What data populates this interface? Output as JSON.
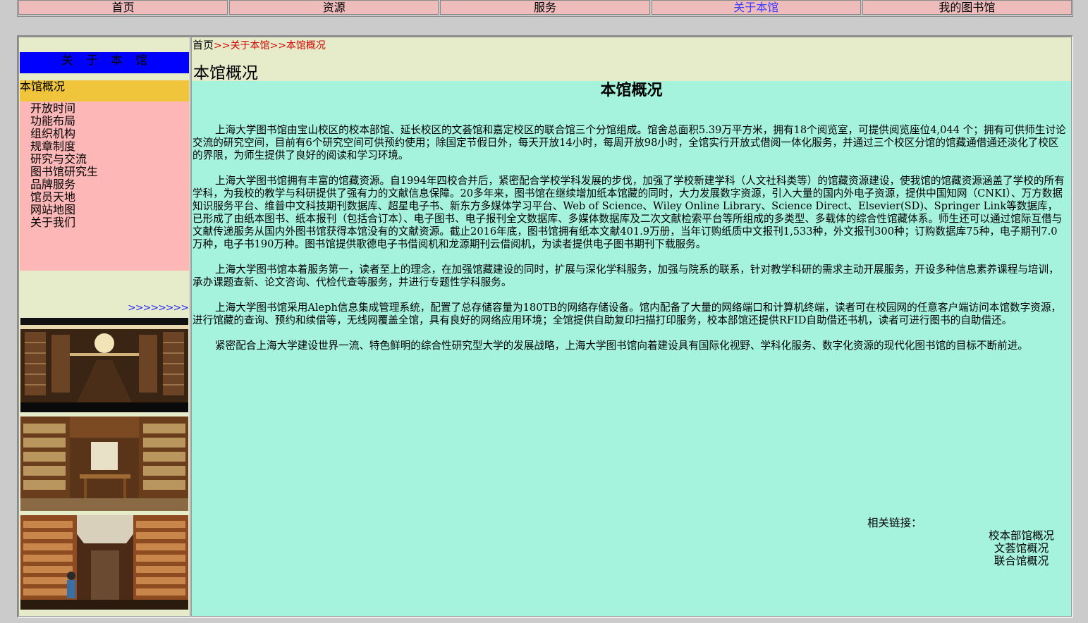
{
  "topnav": {
    "items": [
      {
        "label": "首页"
      },
      {
        "label": "资源"
      },
      {
        "label": "服务"
      },
      {
        "label": "关于本馆"
      },
      {
        "label": "我的图书馆"
      }
    ]
  },
  "sidebar": {
    "header": "关于本馆",
    "current": "本馆概况",
    "items": [
      {
        "label": "开放时间"
      },
      {
        "label": "功能布局"
      },
      {
        "label": "组织机构"
      },
      {
        "label": "规章制度"
      },
      {
        "label": "研究与交流"
      },
      {
        "label": "图书馆研究生"
      },
      {
        "label": "品牌服务"
      },
      {
        "label": "馆员天地"
      },
      {
        "label": "网站地图"
      },
      {
        "label": "关于我们"
      }
    ],
    "more": ">>>>>>>>"
  },
  "breadcrumb": {
    "home": "首页",
    "trail": ">>关于本馆>>本馆概况"
  },
  "main": {
    "page_title": "本馆概况",
    "article_title": "本馆概况",
    "paragraphs": [
      "上海大学图书馆由宝山校区的校本部馆、延长校区的文荟馆和嘉定校区的联合馆三个分馆组成。馆舍总面积5.39万平方米，拥有18个阅览室，可提供阅览座位4,044 个；拥有可供师生讨论交流的研究空间，目前有6个研究空间可供预约使用；除国定节假日外，每天开放14小时，每周开放98小时，全馆实行开放式借阅一体化服务，并通过三个校区分馆的馆藏通借通还淡化了校区的界限，为师生提供了良好的阅读和学习环境。",
      "上海大学图书馆拥有丰富的馆藏资源。自1994年四校合并后，紧密配合学校学科发展的步伐，加强了学校新建学科（人文社科类等）的馆藏资源建设，使我馆的馆藏资源涵盖了学校的所有学科，为我校的教学与科研提供了强有力的文献信息保障。20多年来，图书馆在继续增加纸本馆藏的同时，大力发展数字资源，引入大量的国内外电子资源，提供中国知网（CNKI）、万方数据知识服务平台、维普中文科技期刊数据库、超星电子书、新东方多媒体学习平台、Web of Science、Wiley Online Library、Science Direct、Elsevier(SD)、Springer Link等数据库，已形成了由纸本图书、纸本报刊（包括合订本）、电子图书、电子报刊全文数据库、多媒体数据库及二次文献检索平台等所组成的多类型、多载体的综合性馆藏体系。师生还可以通过馆际互借与文献传递服务从国内外图书馆获得本馆没有的文献资源。截止2016年底，图书馆拥有纸本文献401.9万册，当年订购纸质中文报刊1,533种，外文报刊300种；订购数据库75种，电子期刊7.0万种，电子书190万种。图书馆提供歌德电子书借阅机和龙源期刊云借阅机，为读者提供电子图书期刊下载服务。",
      "上海大学图书馆本着服务第一，读者至上的理念，在加强馆藏建设的同时，扩展与深化学科服务，加强与院系的联系，针对教学科研的需求主动开展服务，开设多种信息素养课程与培训，承办课题查新、论文咨询、代检代查等服务，并进行专题性学科服务。",
      "上海大学图书馆采用Aleph信息集成管理系统，配置了总存储容量为180TB的网络存储设备。馆内配备了大量的网络端口和计算机终端，读者可在校园网的任意客户端访问本馆数字资源，进行馆藏的查询、预约和续借等，无线网覆盖全馆，具有良好的网络应用环境；全馆提供自助复印扫描打印服务，校本部馆还提供RFID自助借还书机，读者可进行图书的自助借还。",
      "紧密配合上海大学建设世界一流、特色鲜明的综合性研究型大学的发展战略，上海大学图书馆向着建设具有国际化视野、学科化服务、数字化资源的现代化图书馆的目标不断前进。"
    ],
    "related_label": "相关链接：",
    "related_links": [
      {
        "label": "校本部馆概况"
      },
      {
        "label": "文荟馆概况"
      },
      {
        "label": "联合馆概况"
      }
    ]
  },
  "colors": {
    "nav_bg": "#efbcbc",
    "nav_active": "#3d3dff",
    "sidebar_header": "#0000ff",
    "sidebar_current": "#f0c53c",
    "sidebar_menu": "#fdb7b7",
    "main_bg": "#a5f3dc",
    "breadcrumb_trail": "#d40000"
  }
}
